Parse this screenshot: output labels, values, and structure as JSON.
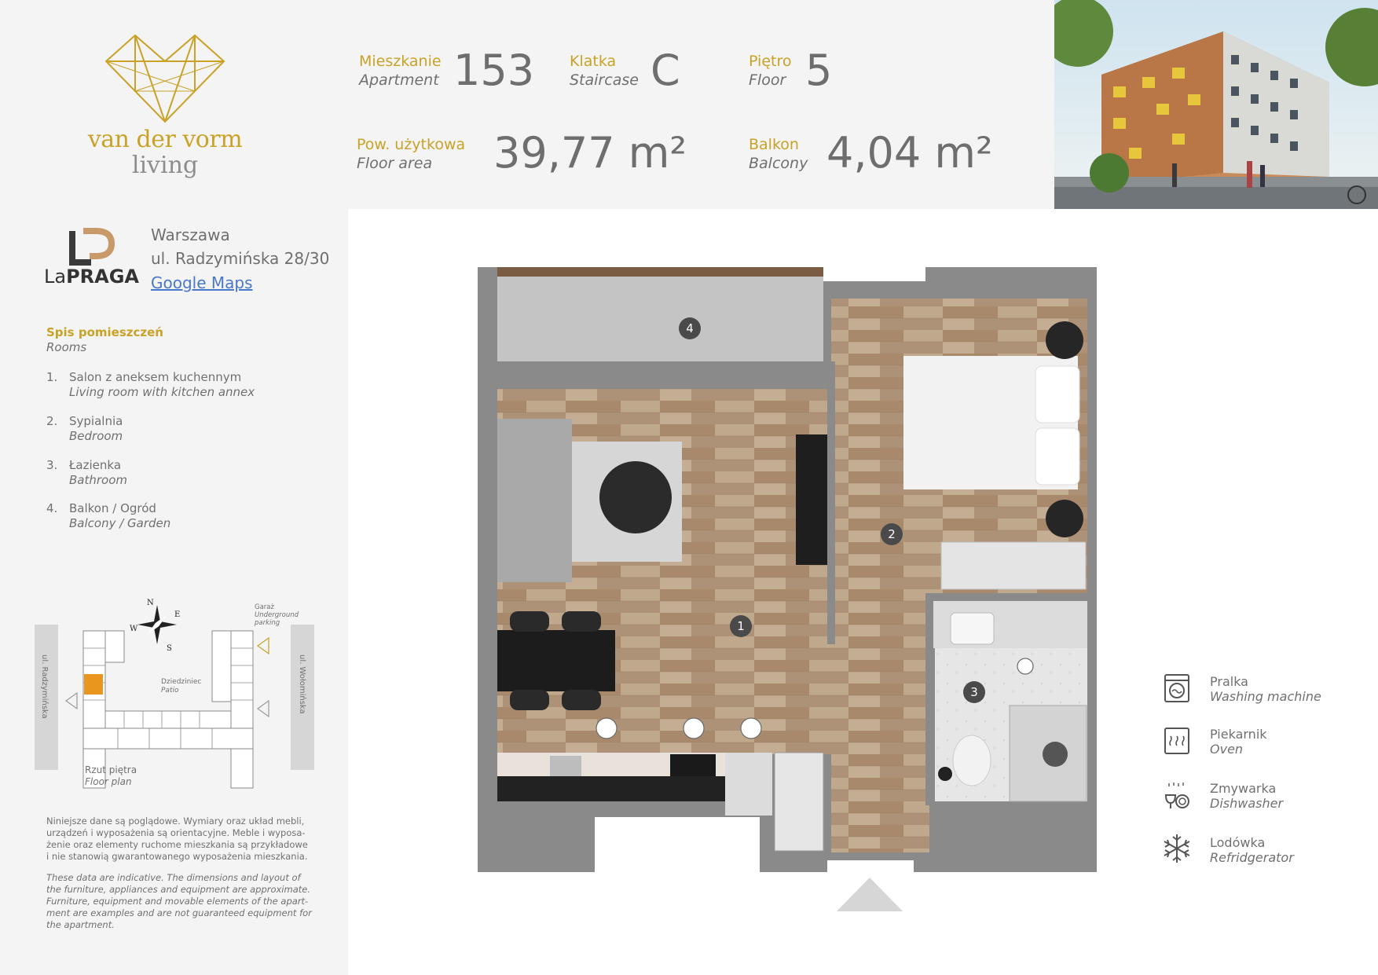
{
  "brand": {
    "name_line1": "van der vorm",
    "name_line2": "living"
  },
  "header": {
    "apartment": {
      "label": "Mieszkanie",
      "sub": "Apartment",
      "value": "153"
    },
    "staircase": {
      "label": "Klatka",
      "sub": "Staircase",
      "value": "C"
    },
    "floor": {
      "label": "Piętro",
      "sub": "Floor",
      "value": "5"
    },
    "floor_area": {
      "label": "Pow. użytkowa",
      "sub": "Floor area",
      "value": "39,77 m²"
    },
    "balcony": {
      "label": "Balkon",
      "sub": "Balcony",
      "value": "4,04 m²"
    }
  },
  "project": {
    "logo_prefix": "La",
    "logo_name": "PRAGA",
    "city": "Warszawa",
    "street": "ul. Radzymińska 28/30",
    "map_link": "Google Maps"
  },
  "rooms": {
    "title": "Spis pomieszczeń",
    "subtitle": "Rooms",
    "items": [
      {
        "num": "1.",
        "pl": "Salon z aneksem kuchennym",
        "en": "Living room with kitchen annex"
      },
      {
        "num": "2.",
        "pl": "Sypialnia",
        "en": "Bedroom"
      },
      {
        "num": "3.",
        "pl": "Łazienka",
        "en": "Bathroom"
      },
      {
        "num": "4.",
        "pl": "Balkon / Ogród",
        "en": "Balcony / Garden"
      }
    ]
  },
  "siteplan": {
    "street_left": "ul. Radzymińska",
    "street_right": "ul. Wołomińska",
    "garage_pl": "Garaż",
    "garage_en_1": "Underground",
    "garage_en_2": "parking",
    "patio_pl": "Dziedziniec",
    "patio_en": "Patio",
    "caption_pl": "Rzut piętra",
    "caption_en": "Floor plan",
    "compass": {
      "n": "N",
      "e": "E",
      "s": "S",
      "w": "W"
    }
  },
  "disclaimer": {
    "pl": [
      "Niniejsze dane są poglądowe. Wymiary oraz układ mebli,",
      "urządzeń i wyposażenia są orientacyjne. Meble i wyposa-",
      "żenie oraz elementy ruchome mieszkania są przykładowe",
      "i nie stanowią gwarantowanego wyposażenia mieszkania."
    ],
    "en": [
      "These data are indicative. The dimensions and layout of",
      "the furniture, appliances and equipment are approximate.",
      "Furniture, equipment and movable elements of the apart-",
      "ment are examples and are not guaranteed equipment for",
      "the apartment."
    ]
  },
  "plan_markers": [
    "1",
    "2",
    "3",
    "4"
  ],
  "legend": [
    {
      "icon": "washing-machine-icon",
      "pl": "Pralka",
      "en": "Washing machine"
    },
    {
      "icon": "oven-icon",
      "pl": "Piekarnik",
      "en": "Oven"
    },
    {
      "icon": "dishwasher-icon",
      "pl": "Zmywarka",
      "en": "Dishwasher"
    },
    {
      "icon": "refrigerator-icon",
      "pl": "Lodówka",
      "en": "Refridgerator"
    }
  ],
  "colors": {
    "accent": "#c9a227",
    "text": "#707070",
    "wall": "#8a8a8a",
    "floor": "#b39a7e",
    "highlight": "#e8961e"
  }
}
